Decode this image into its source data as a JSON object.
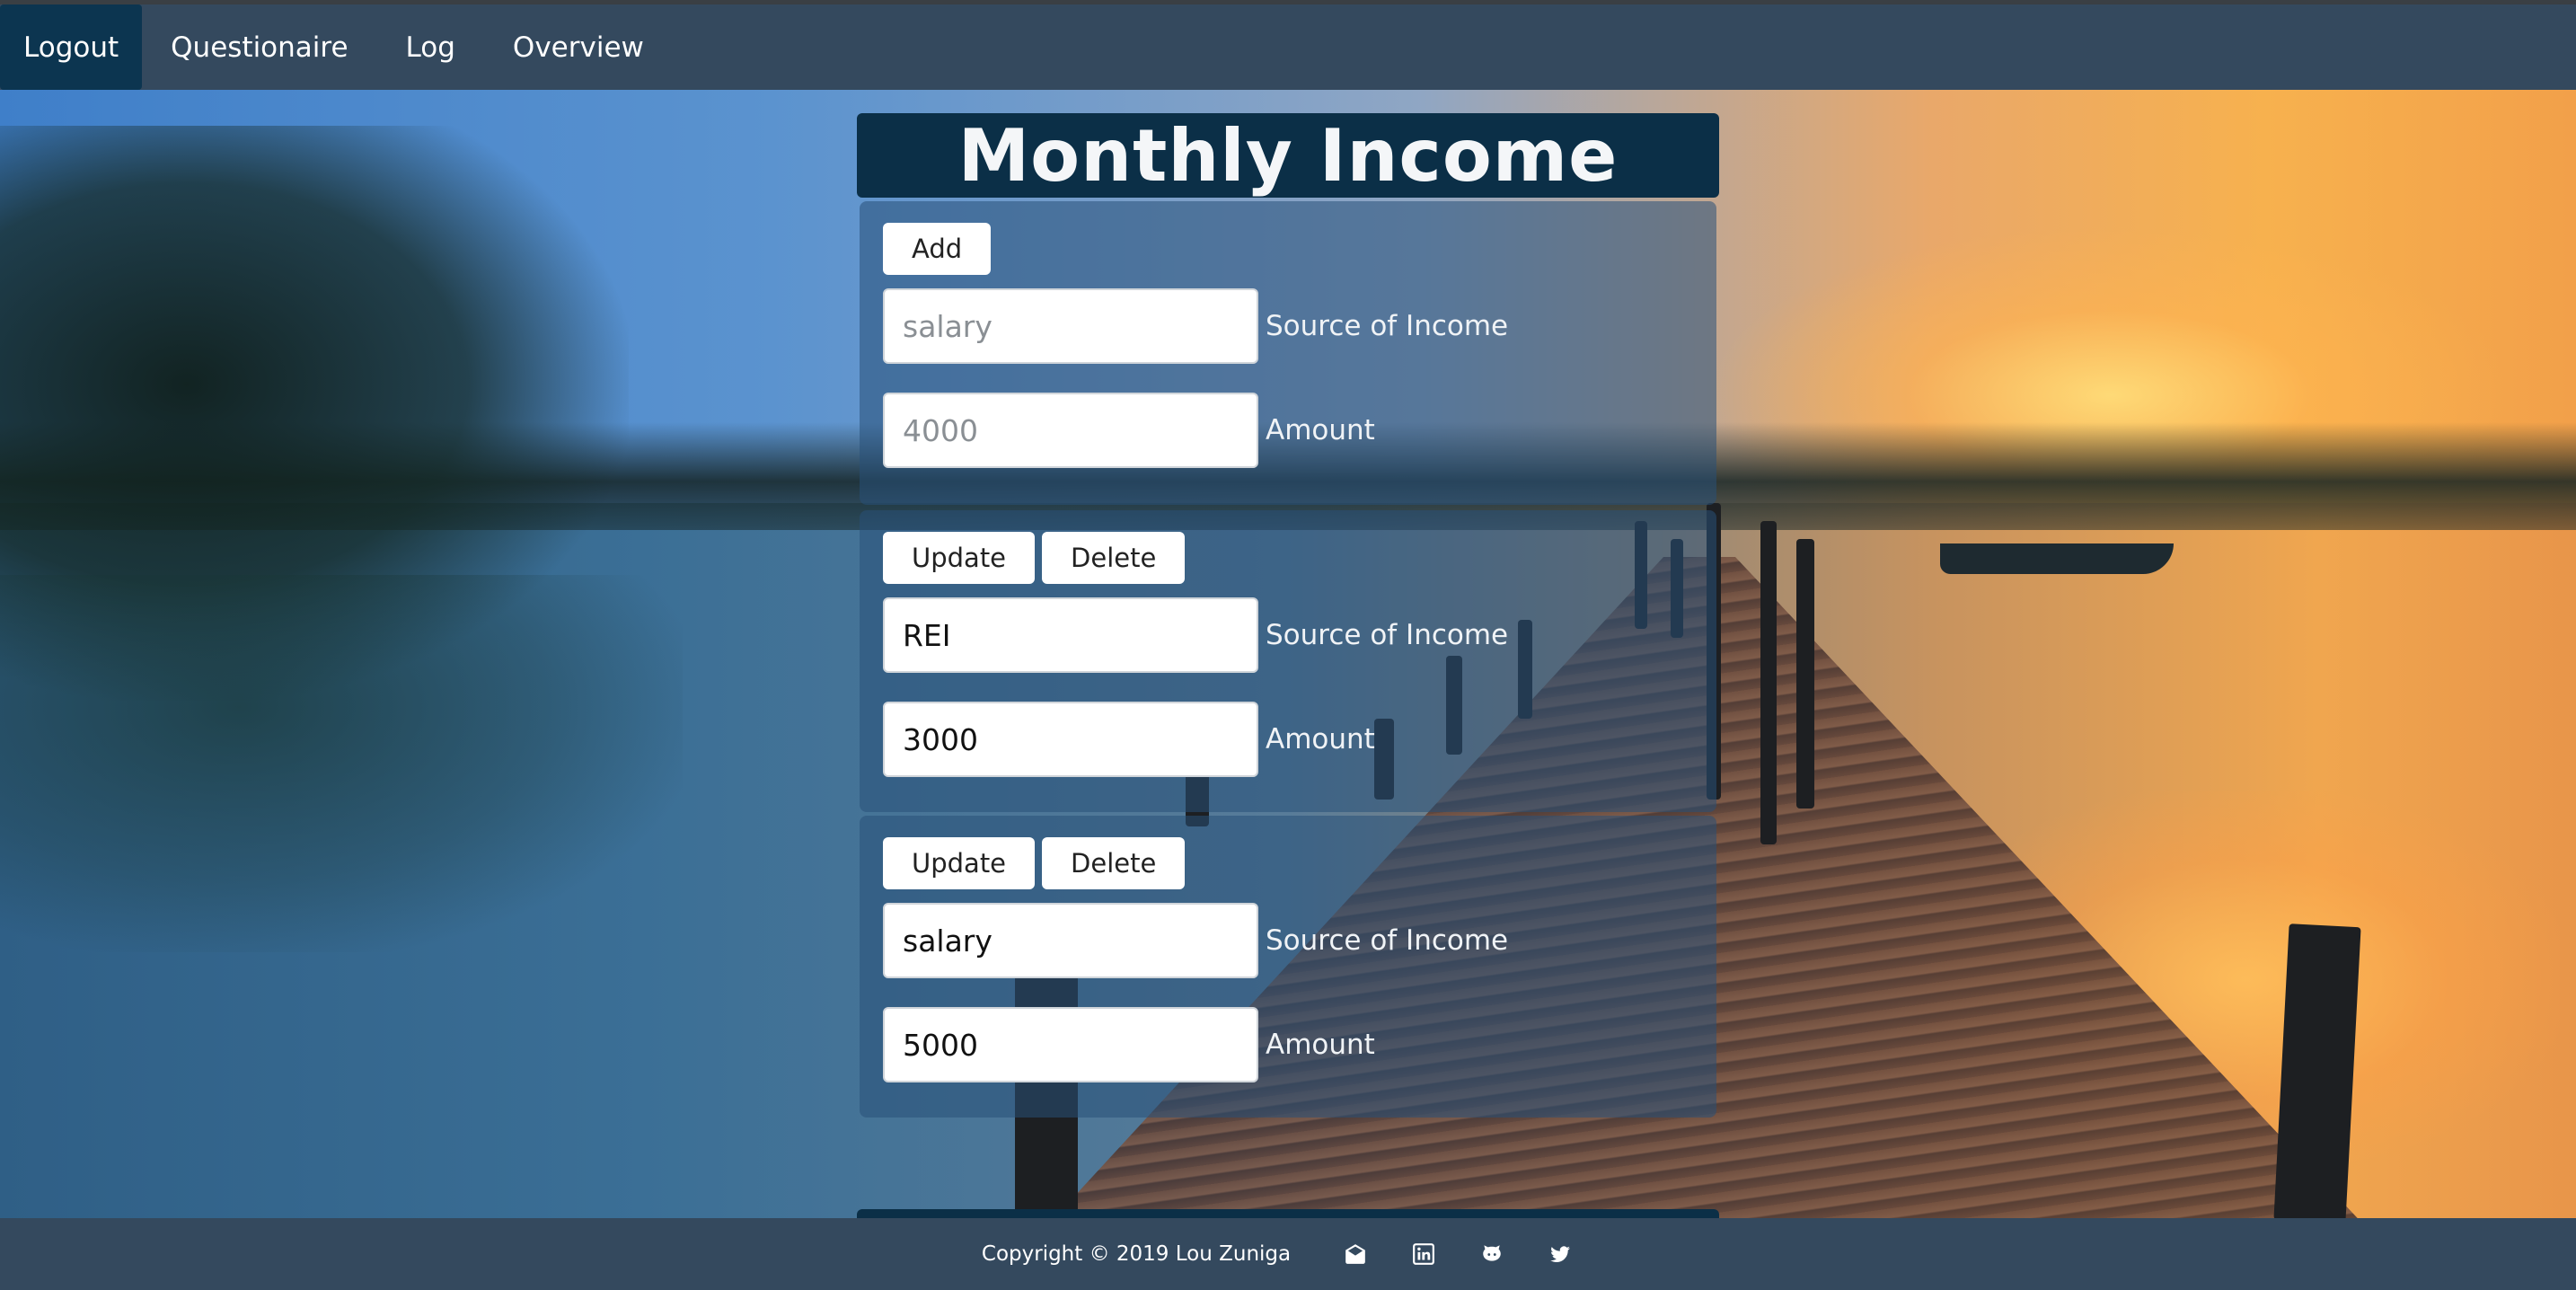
{
  "nav": {
    "items": [
      {
        "label": "Logout",
        "active": true
      },
      {
        "label": "Questionaire",
        "active": false
      },
      {
        "label": "Log",
        "active": false
      },
      {
        "label": "Overview",
        "active": false
      }
    ]
  },
  "page": {
    "title": "Monthly Income"
  },
  "add_form": {
    "add_label": "Add",
    "source_placeholder": "salary",
    "source_label": "Source of Income",
    "amount_placeholder": "4000",
    "amount_label": "Amount"
  },
  "entries": [
    {
      "update_label": "Update",
      "delete_label": "Delete",
      "source_value": "REI",
      "source_label": "Source of Income",
      "amount_value": "3000",
      "amount_label": "Amount"
    },
    {
      "update_label": "Update",
      "delete_label": "Delete",
      "source_value": "salary",
      "source_label": "Source of Income",
      "amount_value": "5000",
      "amount_label": "Amount"
    }
  ],
  "footer": {
    "copyright": "Copyright © 2019 Lou Zuniga",
    "icons": [
      "mail-icon",
      "linkedin-icon",
      "github-icon",
      "twitter-icon"
    ]
  },
  "colors": {
    "navbar": "#34495e",
    "nav_active": "#0c3550",
    "title_bg": "#0b2f47"
  }
}
